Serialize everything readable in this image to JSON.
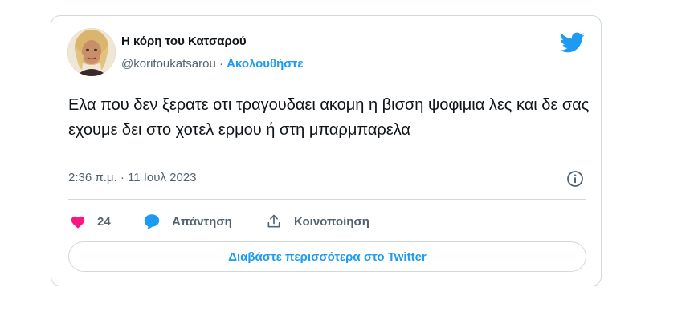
{
  "tweet": {
    "author": {
      "display_name": "Η κόρη του Κατσαρού",
      "handle": "@koritoukatsarou",
      "separator": " · ",
      "follow_label": "Ακολουθήστε",
      "avatar_icon": "avatar-photo"
    },
    "logo_icon": "twitter-bird-icon",
    "text": "Ελα που δεν ξερατε οτι τραγουδαει ακομη η βισση ψοφιμια λες και δε σας εχουμε δει στο χοτελ ερμου ή στη μπαρμπαρελα",
    "timestamp": "2:36 π.μ. · 11 Ιουλ 2023",
    "info_icon": "info-icon",
    "actions": {
      "like_count": "24",
      "reply_label": "Απάντηση",
      "share_label": "Κοινοποίηση"
    },
    "read_more_label": "Διαβάστε περισσότερα στο Twitter",
    "colors": {
      "accent": "#1d9bf0",
      "heart": "#f91880",
      "text": "#0f1419",
      "secondary": "#536471",
      "border": "#cfd9de"
    }
  }
}
